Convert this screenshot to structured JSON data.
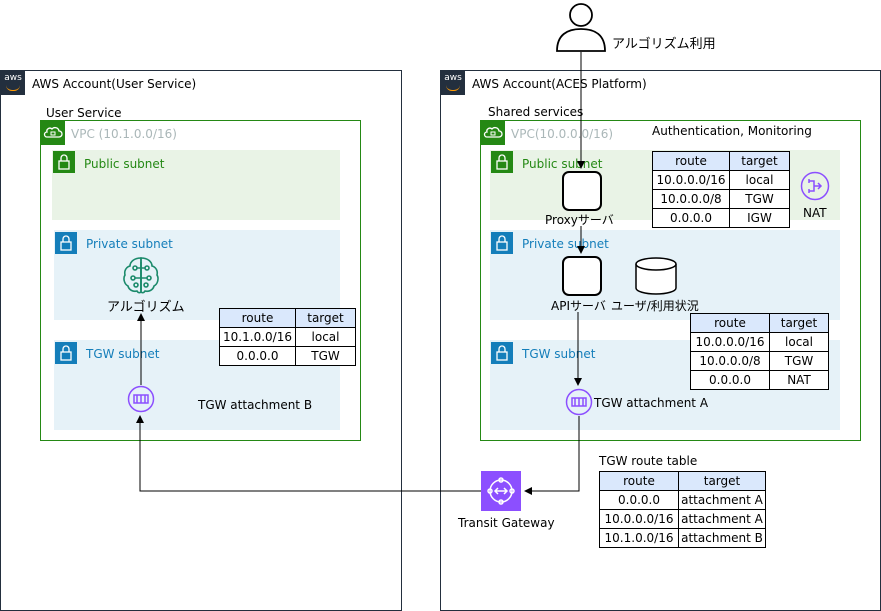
{
  "user": {
    "label": "アルゴリズム利用"
  },
  "left_account": {
    "title": "AWS Account(User Service)",
    "group_label": "User Service",
    "vpc_label": "VPC (10.1.0.0/16)",
    "public_subnet": "Public subnet",
    "private_subnet": "Private subnet",
    "tgw_subnet": "TGW subnet",
    "algorithm_label": "アルゴリズム",
    "tgw_attachment": "TGW attachment B",
    "route_table": {
      "headers": [
        "route",
        "target"
      ],
      "rows": [
        [
          "10.1.0.0/16",
          "local"
        ],
        [
          "0.0.0.0",
          "TGW"
        ]
      ]
    }
  },
  "right_account": {
    "title": "AWS Account(ACES Platform)",
    "group_label": "Shared services",
    "vpc_label": "VPC(10.0.0.0/16)",
    "vpc_note": "Authentication, Monitoring",
    "public_subnet": "Public subnet",
    "private_subnet": "Private subnet",
    "tgw_subnet": "TGW subnet",
    "proxy_label": "Proxyサーバ",
    "api_label": "APIサーバ",
    "db_label": "ユーザ/利用状況",
    "nat_label": "NAT",
    "tgw_attachment": "TGW attachment A",
    "public_route_table": {
      "headers": [
        "route",
        "target"
      ],
      "rows": [
        [
          "10.0.0.0/16",
          "local"
        ],
        [
          "10.0.0.0/8",
          "TGW"
        ],
        [
          "0.0.0.0",
          "IGW"
        ]
      ]
    },
    "private_route_table": {
      "headers": [
        "route",
        "target"
      ],
      "rows": [
        [
          "10.0.0.0/16",
          "local"
        ],
        [
          "10.0.0.0/8",
          "TGW"
        ],
        [
          "0.0.0.0",
          "NAT"
        ]
      ]
    }
  },
  "transit_gateway": {
    "label": "Transit Gateway",
    "route_table_title": "TGW route table",
    "route_table": {
      "headers": [
        "route",
        "target"
      ],
      "rows": [
        [
          "0.0.0.0",
          "attachment A"
        ],
        [
          "10.0.0.0/16",
          "attachment A"
        ],
        [
          "10.1.0.0/16",
          "attachment B"
        ]
      ]
    }
  },
  "colors": {
    "vpc_green": "#248814",
    "subnet_blue": "#147eba",
    "public_bg": "#e9f3e6",
    "private_bg": "#e6f2f8",
    "tgw_purple": "#8c4fff",
    "header_bg": "#dae8fc",
    "aws_dark": "#232f3e"
  }
}
